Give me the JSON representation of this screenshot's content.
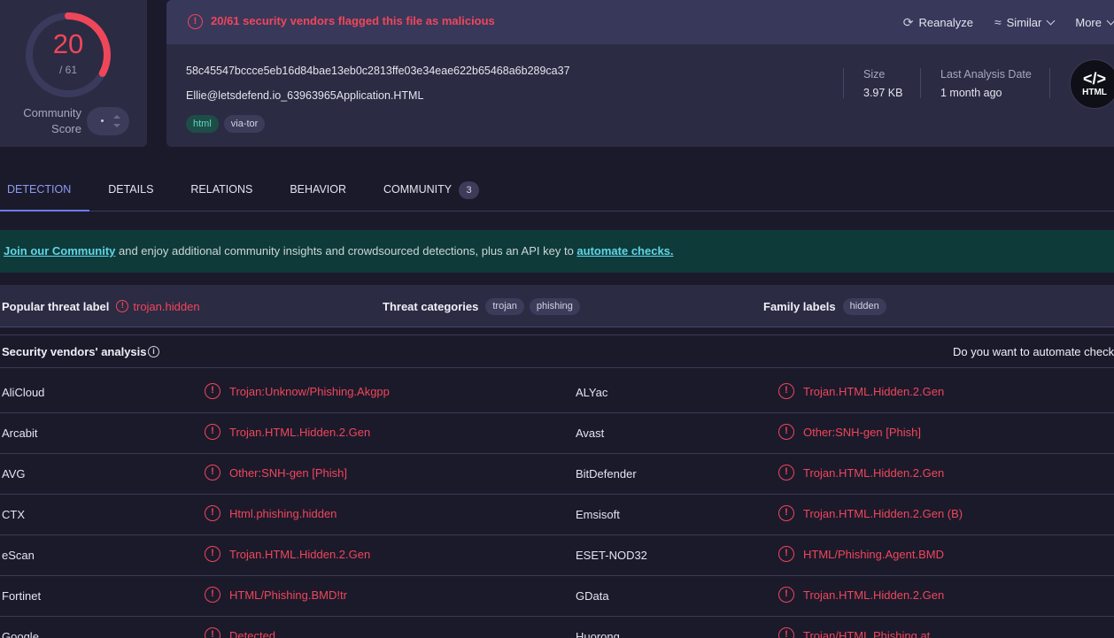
{
  "score": {
    "detected": "20",
    "total": "/ 61",
    "community_label_line1": "Community",
    "community_label_line2": "Score",
    "detected_fraction": 0.328
  },
  "header": {
    "alert": "20/61 security vendors flagged this file as malicious",
    "actions": {
      "reanalyze": "Reanalyze",
      "similar": "Similar",
      "more": "More"
    },
    "hash": "58c45547bccce5eb16d84bae13eb0c2813ffe03e34eae622b65468a6b289ca37",
    "filename": "Ellie@letsdefend.io_63963965Application.HTML",
    "tags": [
      "html",
      "via-tor"
    ],
    "size_label": "Size",
    "size_value": "3.97 KB",
    "date_label": "Last Analysis Date",
    "date_value": "1 month ago",
    "file_icon_code": "</>",
    "file_icon_ext": "HTML"
  },
  "tabs": [
    {
      "label": "DETECTION",
      "active": true
    },
    {
      "label": "DETAILS"
    },
    {
      "label": "RELATIONS"
    },
    {
      "label": "BEHAVIOR"
    },
    {
      "label": "COMMUNITY",
      "badge": "3"
    }
  ],
  "banner": {
    "link1": "Join our Community",
    "middle": " and enjoy additional community insights and crowdsourced detections, plus an API key to ",
    "link2": "automate checks."
  },
  "threat": {
    "popular_label": "Popular threat label",
    "popular_value": "trojan.hidden",
    "categories_label": "Threat categories",
    "categories": [
      "trojan",
      "phishing"
    ],
    "family_label": "Family labels",
    "families": [
      "hidden"
    ]
  },
  "vendors_header": {
    "title": "Security vendors' analysis",
    "right_text": "Do you want to automate checks?"
  },
  "vendors": [
    {
      "left_name": "AliCloud",
      "left_result": "Trojan:Unknow/Phishing.Akgpp",
      "right_name": "ALYac",
      "right_result": "Trojan.HTML.Hidden.2.Gen"
    },
    {
      "left_name": "Arcabit",
      "left_result": "Trojan.HTML.Hidden.2.Gen",
      "right_name": "Avast",
      "right_result": "Other:SNH-gen [Phish]"
    },
    {
      "left_name": "AVG",
      "left_result": "Other:SNH-gen [Phish]",
      "right_name": "BitDefender",
      "right_result": "Trojan.HTML.Hidden.2.Gen"
    },
    {
      "left_name": "CTX",
      "left_result": "Html.phishing.hidden",
      "right_name": "Emsisoft",
      "right_result": "Trojan.HTML.Hidden.2.Gen (B)"
    },
    {
      "left_name": "eScan",
      "left_result": "Trojan.HTML.Hidden.2.Gen",
      "right_name": "ESET-NOD32",
      "right_result": "HTML/Phishing.Agent.BMD"
    },
    {
      "left_name": "Fortinet",
      "left_result": "HTML/Phishing.BMD!tr",
      "right_name": "GData",
      "right_result": "Trojan.HTML.Hidden.2.Gen"
    },
    {
      "left_name": "Google",
      "left_result": "Detected",
      "right_name": "Huorong",
      "right_result": "Trojan/HTML.Phishing.at"
    }
  ]
}
